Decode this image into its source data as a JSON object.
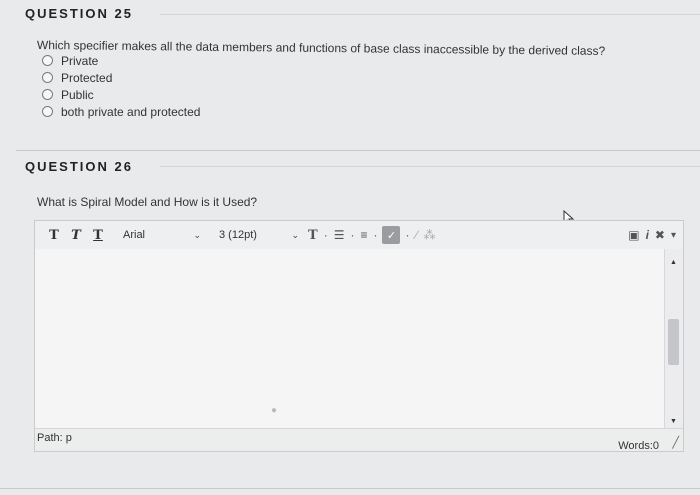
{
  "q25": {
    "title": "QUESTION 25",
    "text": "Which specifier makes all the data members and functions of base class inaccessible by the derived class?",
    "options": [
      {
        "label": "Private"
      },
      {
        "label": "Protected"
      },
      {
        "label": "Public"
      },
      {
        "label": "both private and protected"
      }
    ]
  },
  "q26": {
    "title": "QUESTION 26",
    "text": "What is Spiral Model and How is it Used?"
  },
  "editor": {
    "toolbar": {
      "font_name": "Arial",
      "font_size": "3 (12pt)"
    },
    "status": {
      "path": "Path: p",
      "words": "Words:0"
    }
  },
  "icons": {
    "bold": "bold-icon",
    "italic": "italic-icon",
    "underline": "underline-icon",
    "text_color": "text-color-icon",
    "bullet_list": "bullet-list-icon",
    "numbered_list": "numbered-list-icon",
    "spellcheck": "spellcheck-icon",
    "link": "link-icon",
    "unlink": "unlink-icon",
    "preview": "preview-icon",
    "info": "info-icon",
    "fullscreen": "fullscreen-icon",
    "more": "more-icon"
  }
}
